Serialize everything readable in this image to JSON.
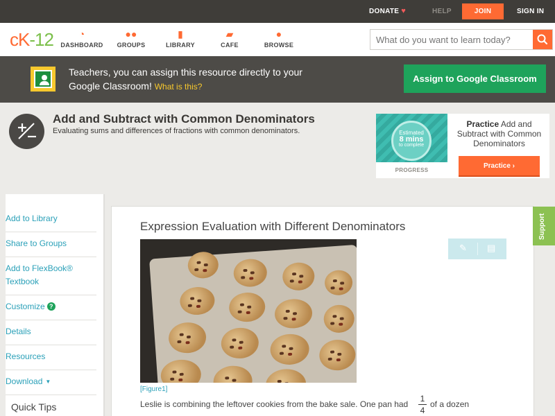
{
  "topbar": {
    "donate": "DONATE",
    "help": "HELP",
    "join": "JOIN",
    "signin": "SIGN IN"
  },
  "logo": {
    "c": "c",
    "k": "K",
    "n": "-12"
  },
  "nav": [
    {
      "icon": "dashboard-icon",
      "label": "DASHBOARD"
    },
    {
      "icon": "groups-icon",
      "label": "GROUPS"
    },
    {
      "icon": "library-icon",
      "label": "LIBRARY"
    },
    {
      "icon": "cafe-icon",
      "label": "CAFE"
    },
    {
      "icon": "browse-icon",
      "label": "BROWSE"
    }
  ],
  "search": {
    "placeholder": "What do you want to learn today?"
  },
  "banner": {
    "text": "Teachers, you can assign this resource directly to your Google Classroom!",
    "whatis": "What is this?",
    "button": "Assign to Google Classroom"
  },
  "concept": {
    "title": "Add and Subtract with Common Denominators",
    "subtitle": "Evaluating sums and differences of fractions with common denominators."
  },
  "practice": {
    "estimated": "Estimated",
    "mins": "8 mins",
    "complete": "to complete",
    "progress": "PROGRESS",
    "bold": "Practice",
    "text": "Add and Subtract with Common Denominators",
    "button": "Practice"
  },
  "sidebar": [
    "Add to Library",
    "Share to Groups",
    "Add to FlexBook® Textbook",
    "Customize",
    "Details",
    "Resources",
    "Download"
  ],
  "quicktips": "Quick Tips",
  "content": {
    "title": "Expression Evaluation with Different Denominators",
    "figure_label": "[Figure1]",
    "paragraph": "Leslie is combining the leftover cookies from the bake sale. One pan had",
    "frac_num": "1",
    "frac_den": "4",
    "paragraph_end": "of a dozen"
  },
  "support": "Support"
}
